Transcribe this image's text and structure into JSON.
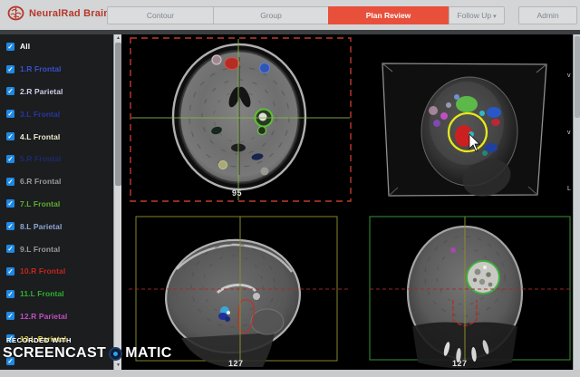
{
  "app": {
    "logo_text": "NeuralRad Brain",
    "brand_color": "#b5382a"
  },
  "nav": {
    "tabs": [
      {
        "label": "Contour",
        "active": false
      },
      {
        "label": "Group",
        "active": false
      },
      {
        "label": "Plan Review",
        "active": true
      },
      {
        "label": "Follow Up",
        "active": false,
        "dropdown": true
      },
      {
        "label": "Admin",
        "active": false
      }
    ],
    "caret": "▾",
    "active_tab_color": "#e8503c"
  },
  "sidebar": {
    "check_glyph": "✓",
    "checkbox_color": "#1e88e5",
    "scroll_up_glyph": "▲",
    "scroll_down_glyph": "▼",
    "items": [
      {
        "label": "All",
        "color": "#ffffff",
        "checked": true
      },
      {
        "label": "1.R Frontal",
        "color": "#3a4fd0",
        "checked": true
      },
      {
        "label": "2.R Parietal",
        "color": "#cfcfe6",
        "checked": true
      },
      {
        "label": "3.L Frontal",
        "color": "#2a35a0",
        "checked": true
      },
      {
        "label": "4.L Frontal",
        "color": "#ece8d2",
        "checked": true
      },
      {
        "label": "5.R Frontal",
        "color": "#1d2a6e",
        "checked": true
      },
      {
        "label": "6.R Frontal",
        "color": "#9a9a9a",
        "checked": true
      },
      {
        "label": "7.L Frontal",
        "color": "#5fae2e",
        "checked": true
      },
      {
        "label": "8.L Parietal",
        "color": "#8fa6d6",
        "checked": true
      },
      {
        "label": "9.L Frontal",
        "color": "#9a9a9a",
        "checked": true
      },
      {
        "label": "10.R Frontal",
        "color": "#c2271b",
        "checked": true
      },
      {
        "label": "11.L Frontal",
        "color": "#2eb02e",
        "checked": true
      },
      {
        "label": "12.R Parietal",
        "color": "#c050c0",
        "checked": true
      },
      {
        "label": "13.L Parietal",
        "color": "#d2c238",
        "checked": true
      },
      {
        "label": "",
        "color": "#ffffff",
        "checked": true
      }
    ]
  },
  "viewports": {
    "axial": {
      "slice": "95",
      "border_color": "#c23a2e",
      "crosshair_color": "#86b44a"
    },
    "three_d": {
      "highlight_color": "#e8e818"
    },
    "sagittal": {
      "slice": "127",
      "frame_color": "#84842c"
    },
    "coronal": {
      "slice": "127",
      "frame_color": "#2f7a2f"
    }
  },
  "edge_fragments": [
    "v",
    "v",
    "L"
  ],
  "watermark": {
    "line1": "RECORDED WITH",
    "brand_left": "SCREENCAST",
    "brand_right": "MATIC"
  }
}
